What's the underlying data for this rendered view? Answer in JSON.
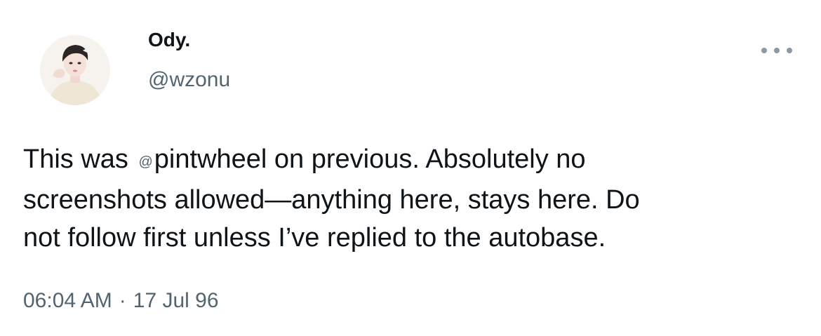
{
  "author": {
    "display_name": "Ody.",
    "handle": "@wzonu",
    "avatar_icon": "profile-photo"
  },
  "more_button": {
    "icon": "more-horizontal-icon"
  },
  "tweet": {
    "line1_before_mention": "This was ",
    "mention_at": "@",
    "mention_user": "pintwheel",
    "line1_after_mention": " on previous. Absolutely no",
    "line2": "screenshots allowed—anything here, stays here. Do",
    "line3": "not follow first unless I’ve replied to the autobase."
  },
  "meta": {
    "time": "06:04 AM",
    "separator": "·",
    "date": "17 Jul 96"
  },
  "colors": {
    "primary_text": "#0f1419",
    "secondary_text": "#536471",
    "background": "#ffffff"
  }
}
